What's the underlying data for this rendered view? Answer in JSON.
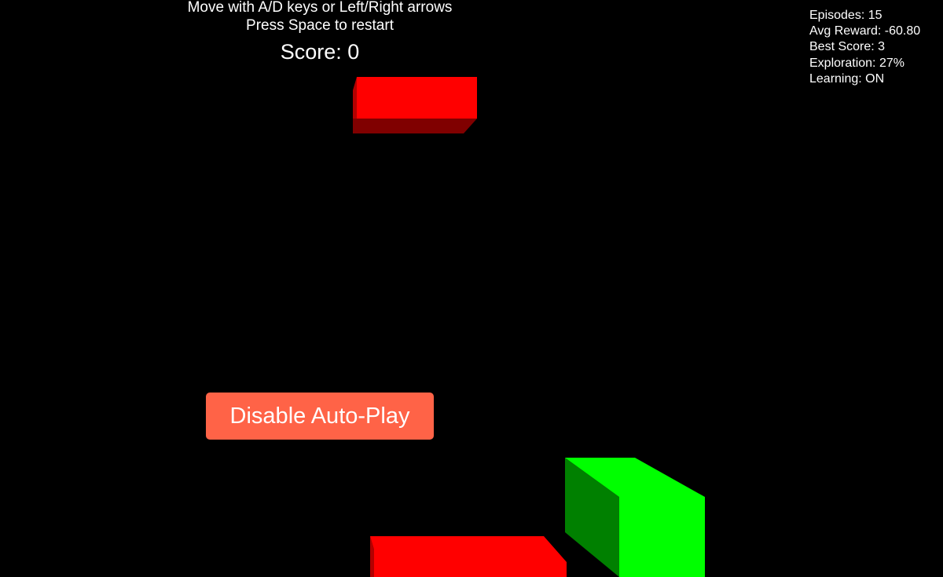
{
  "instructions": {
    "move": "Move with A/D keys or Left/Right arrows",
    "restart": "Press Space to restart"
  },
  "score": {
    "label": "Score: 0",
    "value": 0
  },
  "stats": {
    "episodes": "Episodes: 15",
    "avg_reward": "Avg Reward: -60.80",
    "best_score": "Best Score: 3",
    "exploration": "Exploration: 27%",
    "learning": "Learning: ON"
  },
  "autoplay": {
    "label": "Disable Auto-Play",
    "enabled": true
  },
  "colors": {
    "background": "#000000",
    "text": "#ffffff",
    "obstacle_face": "#ff0000",
    "obstacle_dark": "#800000",
    "obstacle_side": "#b30000",
    "player_face": "#00ff00",
    "player_side": "#008000",
    "button_bg": "#ff6347"
  },
  "scene": {
    "obstacles": 2,
    "player": "green cube"
  }
}
